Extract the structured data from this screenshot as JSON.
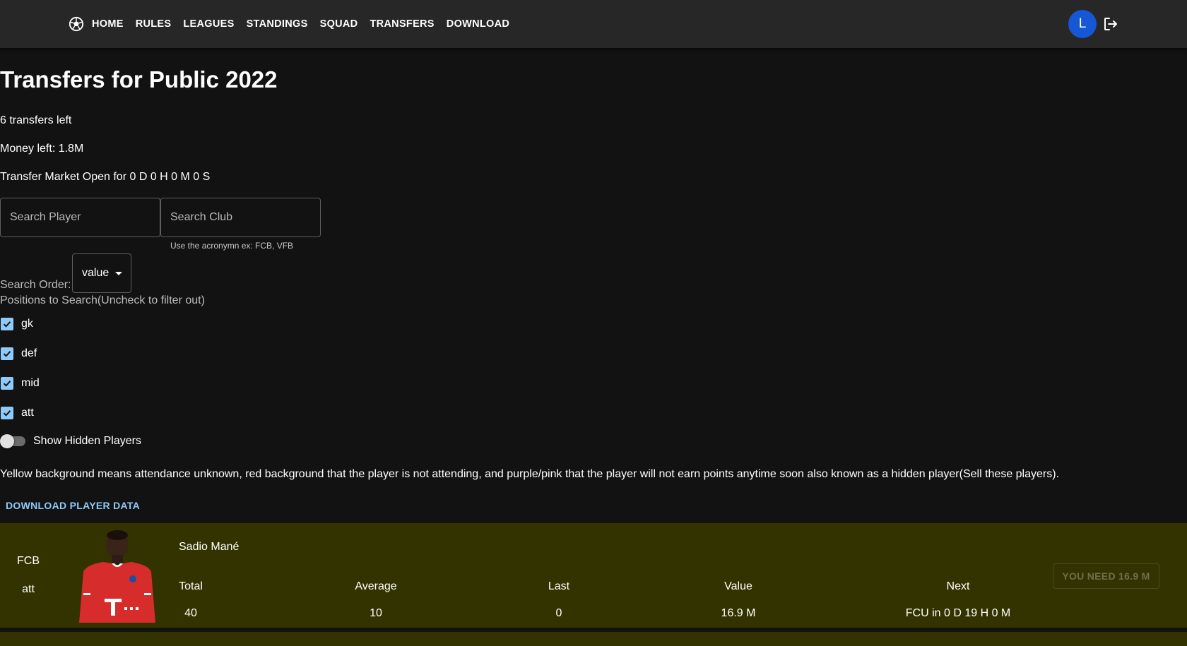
{
  "nav": {
    "items": [
      "HOME",
      "RULES",
      "LEAGUES",
      "STANDINGS",
      "SQUAD",
      "TRANSFERS",
      "DOWNLOAD"
    ],
    "avatar_letter": "L",
    "avatar_color": "#1557d6"
  },
  "page": {
    "title": "Transfers for Public 2022",
    "transfers_left": "6 transfers left",
    "money_left": "Money left: 1.8M",
    "market_open": "Transfer Market Open for 0 D 0 H 0 M 0 S"
  },
  "search": {
    "player_placeholder": "Search Player",
    "club_placeholder": "Search Club",
    "club_helper": "Use the acronymn ex: FCB, VFB",
    "order_label": "Search Order:",
    "order_value": "value"
  },
  "positions": {
    "label": "Positions to Search(Uncheck to filter out)",
    "items": [
      {
        "label": "gk",
        "checked": true
      },
      {
        "label": "def",
        "checked": true
      },
      {
        "label": "mid",
        "checked": true
      },
      {
        "label": "att",
        "checked": true
      }
    ]
  },
  "hidden_toggle": {
    "label": "Show Hidden Players",
    "on": false
  },
  "legend_text": "Yellow background means attendance unknown, red background that the player is not attending, and purple/pink that the player will not earn points anytime soon also known as a hidden player(Sell these players).",
  "download_label": "DOWNLOAD PLAYER DATA",
  "player": {
    "club": "FCB",
    "position": "att",
    "name": "Sadio Mané",
    "headers": {
      "total": "Total",
      "average": "Average",
      "last": "Last",
      "value": "Value",
      "next": "Next"
    },
    "stats": {
      "total": "40",
      "average": "10",
      "last": "0",
      "value": "16.9 M",
      "next": "FCU in 0 D 19 H 0 M"
    },
    "button": "YOU NEED 16.9 M",
    "card_color": "#333300"
  },
  "colors": {
    "background": "#121212",
    "appbar": "#272727",
    "accent": "#90caf9"
  }
}
